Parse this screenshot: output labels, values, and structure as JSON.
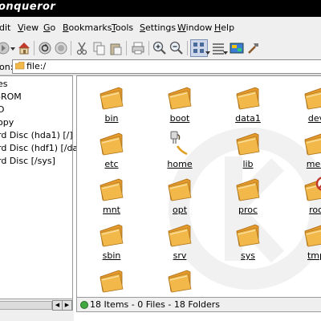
{
  "window": {
    "title": "onqueror"
  },
  "menu": [
    {
      "label": "dit",
      "u": ""
    },
    {
      "label": "iew",
      "u": "V"
    },
    {
      "label": "o",
      "u": "G"
    },
    {
      "label": "ookmarks",
      "u": "B"
    },
    {
      "label": "ools",
      "u": "T"
    },
    {
      "label": "ettings",
      "u": "S"
    },
    {
      "label": "indow",
      "u": "W"
    },
    {
      "label": "elp",
      "u": "H"
    }
  ],
  "location": {
    "label": "on:",
    "value": "file:/"
  },
  "sidebar": {
    "items": [
      {
        "label": "es"
      },
      {
        "label": "-ROM"
      },
      {
        "label": "D"
      },
      {
        "label": "opy"
      },
      {
        "label": "rd Disc (hda1) [/]"
      },
      {
        "label": "rd Disc (hdf1) [/data"
      },
      {
        "label": "rd Disc  [/sys]"
      }
    ]
  },
  "files": [
    {
      "name": "bin",
      "icon": "folder-icon"
    },
    {
      "name": "boot",
      "icon": "folder-icon"
    },
    {
      "name": "data1",
      "icon": "folder-icon"
    },
    {
      "name": "dev",
      "icon": "folder-icon"
    },
    {
      "name": "etc",
      "icon": "folder-icon"
    },
    {
      "name": "home",
      "icon": "folder-home-icon"
    },
    {
      "name": "lib",
      "icon": "folder-icon"
    },
    {
      "name": "med",
      "icon": "folder-icon"
    },
    {
      "name": "mnt",
      "icon": "folder-icon"
    },
    {
      "name": "opt",
      "icon": "folder-icon"
    },
    {
      "name": "proc",
      "icon": "folder-icon"
    },
    {
      "name": "roo",
      "icon": "folder-locked-icon"
    },
    {
      "name": "sbin",
      "icon": "folder-icon"
    },
    {
      "name": "srv",
      "icon": "folder-icon"
    },
    {
      "name": "sys",
      "icon": "folder-icon"
    },
    {
      "name": "tmp",
      "icon": "folder-icon"
    },
    {
      "name": "",
      "icon": "folder-icon"
    },
    {
      "name": "",
      "icon": "folder-icon"
    }
  ],
  "status": {
    "text": "18 Items - 0 Files - 18 Folders"
  },
  "colors": {
    "folder_front": "#f2b84a",
    "folder_back": "#e69a2e",
    "status_ok": "#3fa93f"
  }
}
